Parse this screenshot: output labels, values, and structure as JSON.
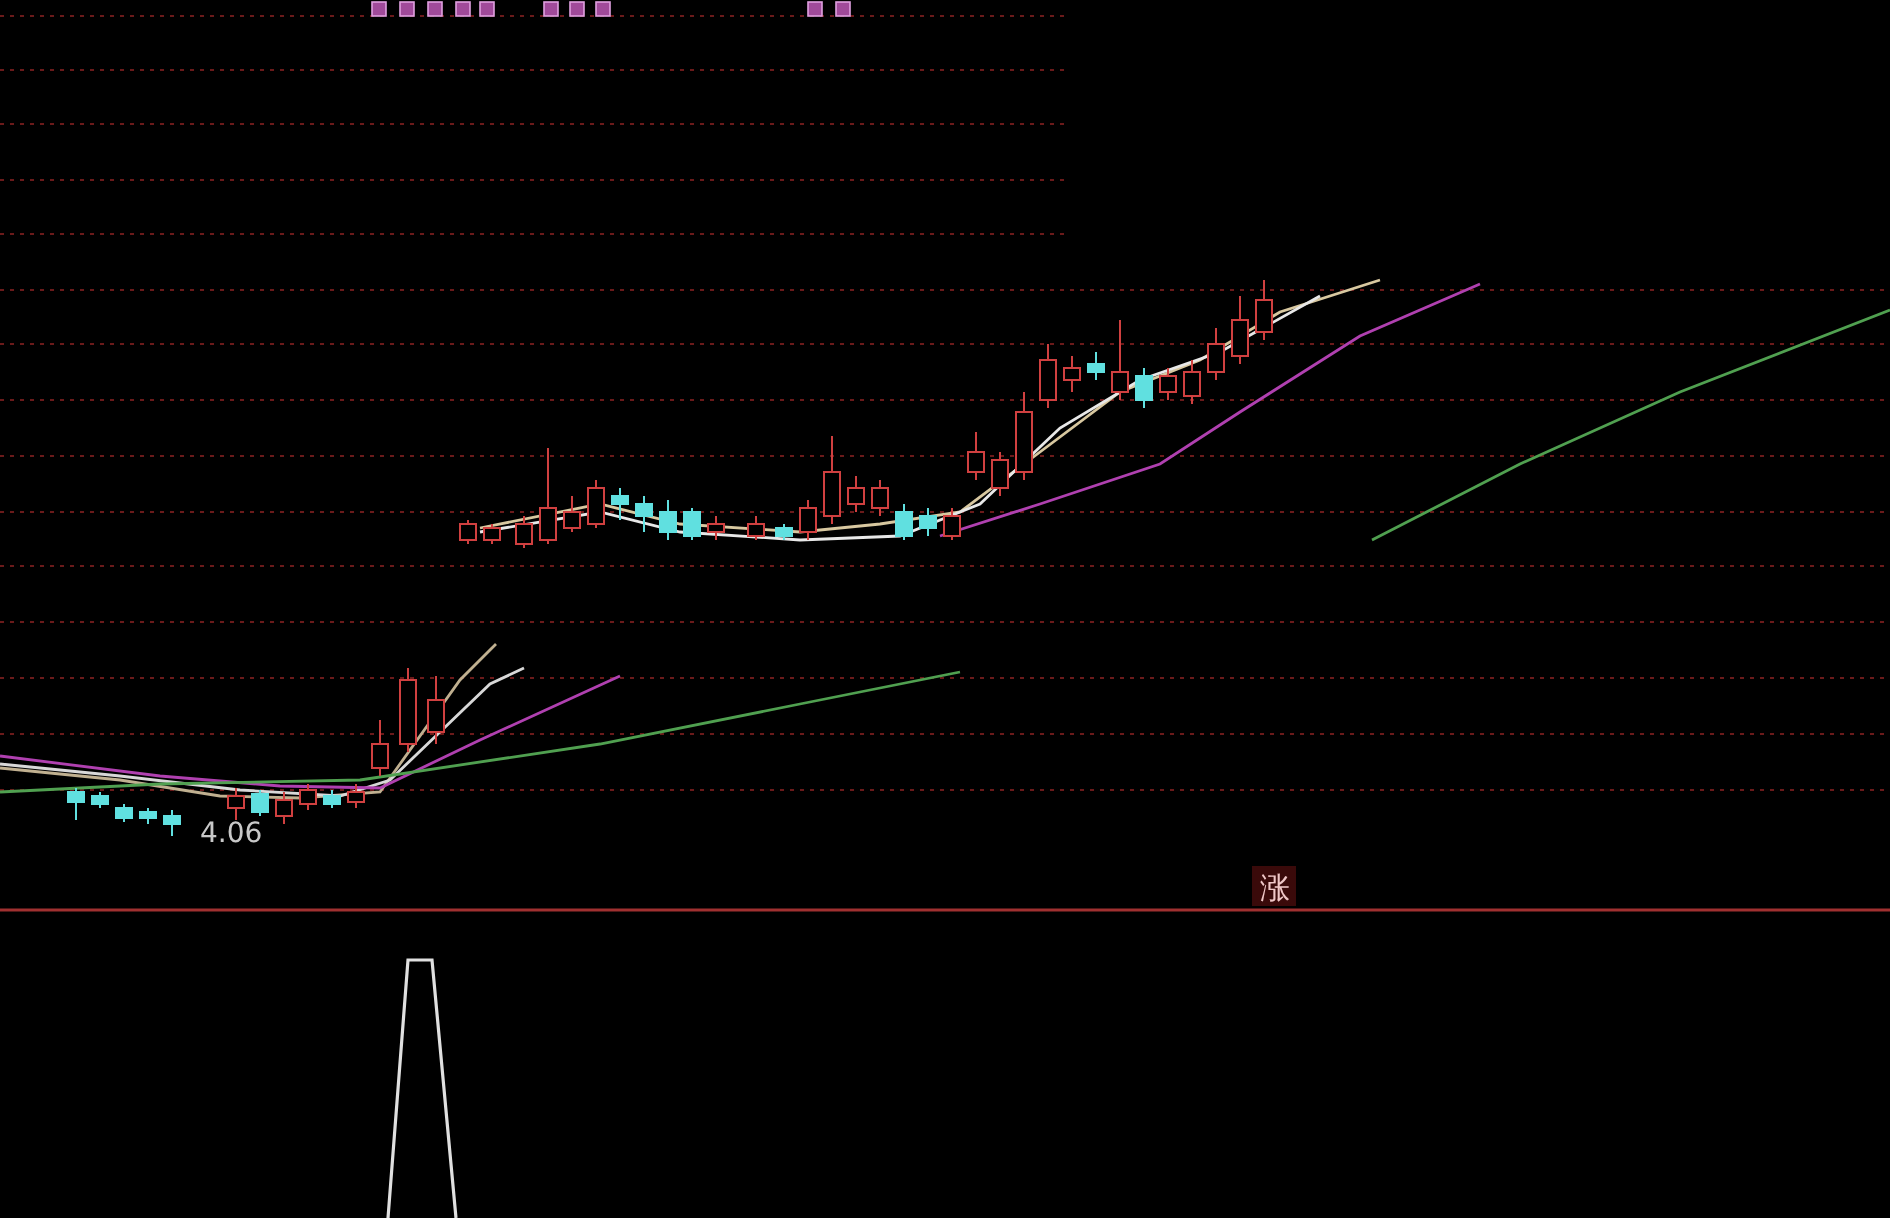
{
  "chart": {
    "price_label": "4.06",
    "signal_label": "涨"
  }
}
